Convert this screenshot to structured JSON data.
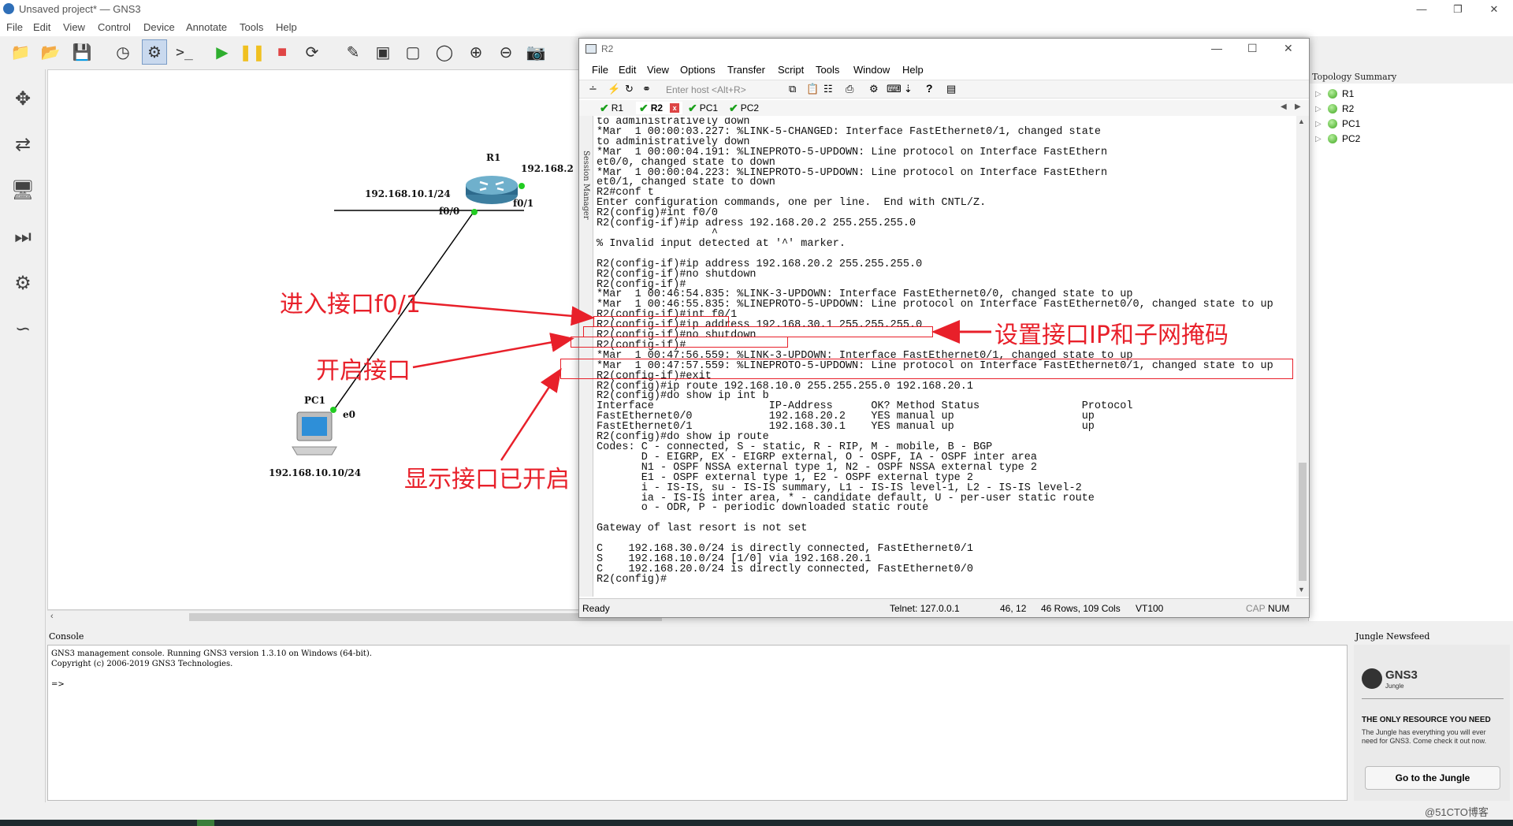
{
  "app": {
    "title": "Unsaved project* — GNS3",
    "menu": [
      "File",
      "Edit",
      "View",
      "Control",
      "Device",
      "Annotate",
      "Tools",
      "Help"
    ]
  },
  "topology": {
    "r1_name": "R1",
    "r1_ip_left": "192.168.10.1/24",
    "r1_ip_right": "192.168.2",
    "r1_if_left": "f0/0",
    "r1_if_right": "f0/1",
    "pc1_name": "PC1",
    "pc1_if": "e0",
    "pc1_ip": "192.168.10.10/24"
  },
  "topology_summary": {
    "header": "Topology Summary",
    "items": [
      "R1",
      "R2",
      "PC1",
      "PC2"
    ]
  },
  "console": {
    "header": "Console",
    "lines": "GNS3 management console. Running GNS3 version 1.3.10 on Windows (64-bit).\nCopyright (c) 2006-2019 GNS3 Technologies.\n\n=>"
  },
  "jungle": {
    "header": "Jungle Newsfeed",
    "brand": "GNS3",
    "brand_sub": "Jungle",
    "headline": "THE ONLY RESOURCE YOU NEED",
    "text": "The Jungle has everything you will ever need for GNS3. Come check it out now.",
    "button": "Go to the Jungle"
  },
  "terminal": {
    "title": "R2",
    "menu": [
      "File",
      "Edit",
      "View",
      "Options",
      "Transfer",
      "Script",
      "Tools",
      "Window",
      "Help"
    ],
    "host_placeholder": "Enter host <Alt+R>",
    "tabs": [
      "R1",
      "R2",
      "PC1",
      "PC2"
    ],
    "session_manager": "Session Manager",
    "screen": "to administratively down\n*Mar  1 00:00:03.227: %LINK-5-CHANGED: Interface FastEthernet0/1, changed state\nto administratively down\n*Mar  1 00:00:04.191: %LINEPROTO-5-UPDOWN: Line protocol on Interface FastEthern\net0/0, changed state to down\n*Mar  1 00:00:04.223: %LINEPROTO-5-UPDOWN: Line protocol on Interface FastEthern\net0/1, changed state to down\nR2#conf t\nEnter configuration commands, one per line.  End with CNTL/Z.\nR2(config)#int f0/0\nR2(config-if)#ip adress 192.168.20.2 255.255.255.0\n                  ^\n% Invalid input detected at '^' marker.\n\nR2(config-if)#ip address 192.168.20.2 255.255.255.0\nR2(config-if)#no shutdown\nR2(config-if)#\n*Mar  1 00:46:54.835: %LINK-3-UPDOWN: Interface FastEthernet0/0, changed state to up\n*Mar  1 00:46:55.835: %LINEPROTO-5-UPDOWN: Line protocol on Interface FastEthernet0/0, changed state to up\nR2(config-if)#int f0/1\nR2(config-if)#ip address 192.168.30.1 255.255.255.0\nR2(config-if)#no shutdown\nR2(config-if)#\n*Mar  1 00:47:56.559: %LINK-3-UPDOWN: Interface FastEthernet0/1, changed state to up\n*Mar  1 00:47:57.559: %LINEPROTO-5-UPDOWN: Line protocol on Interface FastEthernet0/1, changed state to up\nR2(config-if)#exit\nR2(config)#ip route 192.168.10.0 255.255.255.0 192.168.20.1\nR2(config)#do show ip int b\nInterface                  IP-Address      OK? Method Status                Protocol\nFastEthernet0/0            192.168.20.2    YES manual up                    up\nFastEthernet0/1            192.168.30.1    YES manual up                    up\nR2(config)#do show ip route\nCodes: C - connected, S - static, R - RIP, M - mobile, B - BGP\n       D - EIGRP, EX - EIGRP external, O - OSPF, IA - OSPF inter area\n       N1 - OSPF NSSA external type 1, N2 - OSPF NSSA external type 2\n       E1 - OSPF external type 1, E2 - OSPF external type 2\n       i - IS-IS, su - IS-IS summary, L1 - IS-IS level-1, L2 - IS-IS level-2\n       ia - IS-IS inter area, * - candidate default, U - per-user static route\n       o - ODR, P - periodic downloaded static route\n\nGateway of last resort is not set\n\nC    192.168.30.0/24 is directly connected, FastEthernet0/1\nS    192.168.10.0/24 [1/0] via 192.168.20.1\nC    192.168.20.0/24 is directly connected, FastEthernet0/0\nR2(config)#",
    "status": {
      "ready": "Ready",
      "telnet": "Telnet: 127.0.0.1",
      "cursor": "46,  12",
      "size": "46 Rows, 109 Cols",
      "term": "VT100",
      "cap": "CAP",
      "num": "NUM"
    }
  },
  "annotations": {
    "enter_interface": "进入接口f0/1",
    "enable_interface": "开启接口",
    "set_ip": "设置接口IP和子网掩码",
    "show_enabled": "显示接口已开启"
  },
  "watermark": "@51CTO博客",
  "colors": {
    "annotation": "#e8202a",
    "link_dot": "#22cc22"
  }
}
